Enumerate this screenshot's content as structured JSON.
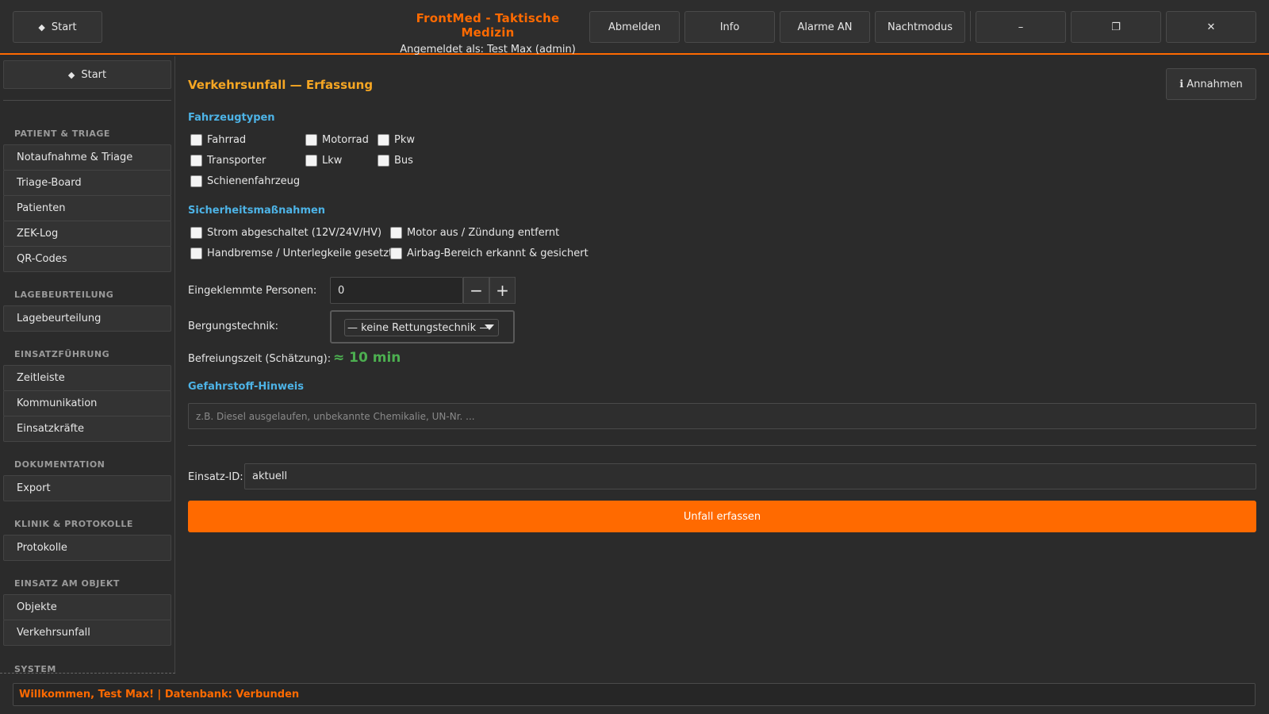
{
  "topbar": {
    "start_label": "Start",
    "start_icon": "diamond-icon",
    "title": "FrontMed - Taktische Medizin",
    "user": "Angemeldet als: Test Max (admin)",
    "buttons": {
      "logout": "Abmelden",
      "info": "Info",
      "alarms": "Alarme AN",
      "night": "Nachtmodus",
      "minimize": "–",
      "maximize": "❐",
      "close": "✕"
    }
  },
  "sidebar": {
    "start_label": "Start",
    "sections": {
      "patient": {
        "heading": "PATIENT & TRIAGE",
        "items": [
          "Notaufnahme & Triage",
          "Triage-Board",
          "Patienten",
          "ZEK-Log",
          "QR-Codes"
        ]
      },
      "lage": {
        "heading": "LAGEBEURTEILUNG",
        "items": [
          "Lagebeurteilung"
        ]
      },
      "einsatz": {
        "heading": "EINSATZFÜHRUNG",
        "items": [
          "Zeitleiste",
          "Kommunikation",
          "Einsatzkräfte"
        ]
      },
      "doku": {
        "heading": "DOKUMENTATION",
        "items": [
          "Export"
        ]
      },
      "klinik": {
        "heading": "KLINIK & PROTOKOLLE",
        "items": [
          "Protokolle"
        ]
      },
      "objekt": {
        "heading": "EINSATZ AM OBJEKT",
        "items": [
          "Objekte",
          "Verkehrsunfall"
        ]
      },
      "system": {
        "heading": "SYSTEM"
      }
    }
  },
  "main": {
    "title": "Verkehrsunfall — Erfassung",
    "assume_button": "ℹ Annahmen",
    "vehicle_heading": "Fahrzeugtypen",
    "vehicles": [
      "Fahrrad",
      "Motorrad",
      "Pkw",
      "Transporter",
      "Lkw",
      "Bus",
      "Schienenfahrzeug"
    ],
    "safety_heading": "Sicherheitsmaßnahmen",
    "safety": [
      "Strom abgeschaltet (12V/24V/HV)",
      "Motor aus / Zündung entfernt",
      "Handbremse / Unterlegkeile gesetzt",
      "Airbag-Bereich erkannt & gesichert"
    ],
    "trapped_label": "Eingeklemmte Personen:",
    "trapped_value": "0",
    "rescue_label": "Bergungstechnik:",
    "rescue_value": "— keine Rettungstechnik —",
    "time_label": "Befreiungszeit (Schätzung):",
    "time_value": "≈ 10 min",
    "hazmat_heading": "Gefahrstoff-Hinweis",
    "hazmat_placeholder": "z.B. Diesel ausgelaufen, unbekannte Chemikalie, UN-Nr. ...",
    "id_label": "Einsatz-ID:",
    "id_value": "aktuell",
    "submit_label": "Unfall erfassen"
  },
  "status": {
    "text": "Willkommen, Test Max! | Datenbank: Verbunden"
  },
  "colors": {
    "accent": "#ff6a00",
    "section": "#4db3e6",
    "title": "#f5a623",
    "ok": "#4caf50"
  }
}
